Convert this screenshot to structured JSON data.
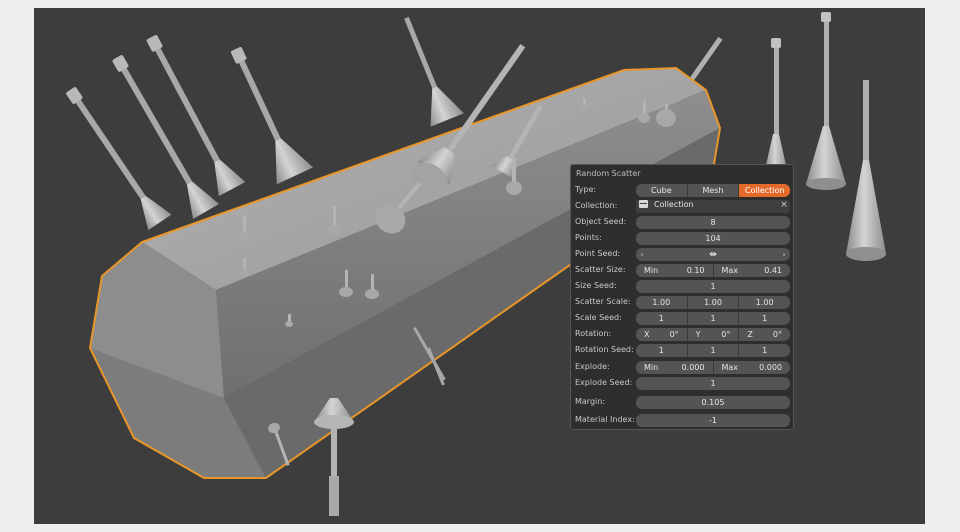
{
  "panel": {
    "title": "Random Scatter",
    "type": {
      "label": "Type:",
      "options": [
        "Cube",
        "Mesh",
        "Collection"
      ],
      "selected": "Collection"
    },
    "collection": {
      "label": "Collection:",
      "value": "Collection",
      "clear_icon": "close-icon"
    },
    "object_seed": {
      "label": "Object Seed:",
      "value": "8"
    },
    "points": {
      "label": "Points:",
      "value": "104"
    },
    "point_seed": {
      "label": "Point Seed:",
      "left_arrow": "‹",
      "right_arrow": "›",
      "cursor": "⇹"
    },
    "scatter_size": {
      "label": "Scatter Size:",
      "min_label": "Min",
      "min": "0.10",
      "max_label": "Max",
      "max": "0.41"
    },
    "size_seed": {
      "label": "Size Seed:",
      "value": "1"
    },
    "scatter_scale": {
      "label": "Scatter Scale:",
      "values": [
        "1.00",
        "1.00",
        "1.00"
      ]
    },
    "scale_seed": {
      "label": "Scale Seed:",
      "values": [
        "1",
        "1",
        "1"
      ]
    },
    "rotation": {
      "label": "Rotation:",
      "x_label": "X",
      "x": "0°",
      "y_label": "Y",
      "y": "0°",
      "z_label": "Z",
      "z": "0°"
    },
    "rotation_seed": {
      "label": "Rotation Seed:",
      "values": [
        "1",
        "1",
        "1"
      ]
    },
    "explode": {
      "label": "Explode:",
      "min_label": "Min",
      "min": "0.000",
      "max_label": "Max",
      "max": "0.000"
    },
    "explode_seed": {
      "label": "Explode Seed:",
      "value": "1"
    },
    "margin": {
      "label": "Margin:",
      "value": "0.105"
    },
    "material_index": {
      "label": "Material Index:",
      "value": "-1"
    }
  },
  "colors": {
    "viewport_bg": "#3d3d3d",
    "selection_outline": "#e8962a",
    "active_button": "#e46a2c"
  }
}
